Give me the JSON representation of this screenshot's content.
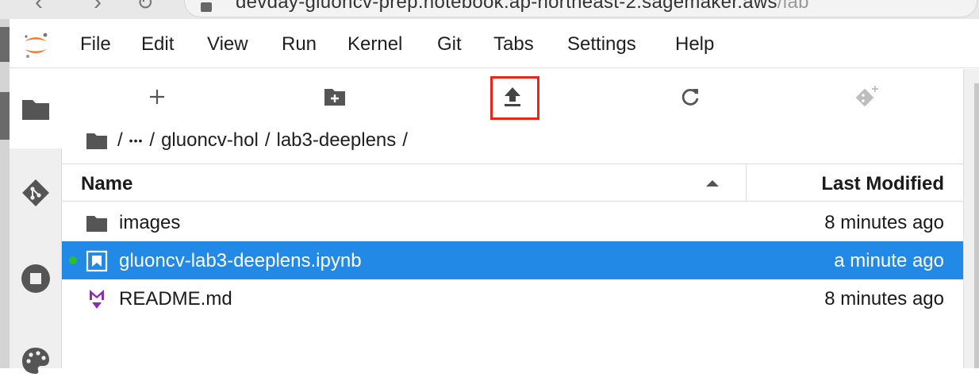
{
  "browser": {
    "url_main": "devday-gluoncv-prep.notebook.ap-northeast-2.sagemaker.aws",
    "url_path": "/lab"
  },
  "menu": {
    "items": [
      "File",
      "Edit",
      "View",
      "Run",
      "Kernel",
      "Git",
      "Tabs",
      "Settings",
      "Help"
    ]
  },
  "toolbar": {
    "new_launcher": "new-launcher-icon",
    "new_folder": "new-folder-icon",
    "upload": "upload-icon",
    "refresh": "refresh-icon",
    "git_clone": "git-clone-icon",
    "highlight_color": "#e8261b"
  },
  "breadcrumb": {
    "root": "/",
    "ellipsis": "•••",
    "sep1": "/",
    "folder1": "gluoncv-hol",
    "sep2": "/",
    "folder2": "lab3-deeplens",
    "sep3": "/"
  },
  "file_list": {
    "header_name": "Name",
    "header_modified": "Last Modified",
    "rows": [
      {
        "name": "images",
        "modified": "8 minutes ago",
        "type": "folder",
        "selected": false
      },
      {
        "name": "gluoncv-lab3-deeplens.ipynb",
        "modified": "a minute ago",
        "type": "notebook",
        "selected": true
      },
      {
        "name": "README.md",
        "modified": "8 minutes ago",
        "type": "markdown",
        "selected": false
      }
    ]
  },
  "colors": {
    "selection": "#2289e6",
    "running": "#26c426",
    "markdown": "#8e2dad",
    "logo": "#f37726"
  }
}
